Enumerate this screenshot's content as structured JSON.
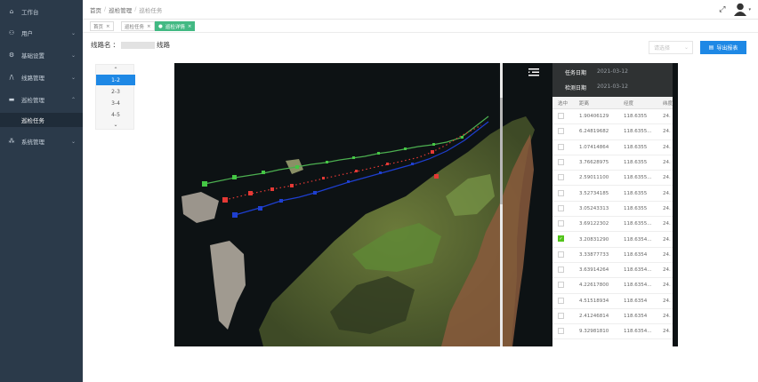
{
  "sidebar": {
    "items": [
      {
        "label": "工作台",
        "icon": "home-icon"
      },
      {
        "label": "用户",
        "icon": "user-icon"
      },
      {
        "label": "基础设置",
        "icon": "settings-icon"
      },
      {
        "label": "线路管理",
        "icon": "route-icon"
      },
      {
        "label": "巡检管理",
        "icon": "folder-icon"
      },
      {
        "label": "巡检任务",
        "icon": ""
      },
      {
        "label": "系统管理",
        "icon": "sitemap-icon"
      }
    ]
  },
  "topbar": {
    "breadcrumb": [
      "首页",
      "巡检管理",
      "巡检任务"
    ]
  },
  "tabs": [
    {
      "label": "首页"
    },
    {
      "label": "巡检任务"
    },
    {
      "label": "巡检详情"
    }
  ],
  "page": {
    "title_prefix": "线路名",
    "title_suffix": "线路"
  },
  "toolbar": {
    "select_placeholder": "请选择",
    "export_label": "导出报表"
  },
  "segments": {
    "up": "⌃",
    "items": [
      "1-2",
      "2-3",
      "3-4",
      "4-5"
    ],
    "down": "⌄",
    "active_index": 0
  },
  "panel": {
    "task_date_label": "任务日期",
    "task_date_value": "2021-03-12",
    "check_date_label": "检测日期",
    "check_date_value": "2021-03-12",
    "columns": [
      "选中",
      "距离",
      "经度",
      "纬度"
    ],
    "rows": [
      {
        "checked": false,
        "distance": "1.90406129",
        "lon": "118.6355",
        "lat": "24."
      },
      {
        "checked": false,
        "distance": "6.24819682",
        "lon": "118.6355...",
        "lat": "24."
      },
      {
        "checked": false,
        "distance": "1.07414864",
        "lon": "118.6355",
        "lat": "24."
      },
      {
        "checked": false,
        "distance": "3.76628975",
        "lon": "118.6355",
        "lat": "24."
      },
      {
        "checked": false,
        "distance": "2.59011100",
        "lon": "118.6355...",
        "lat": "24."
      },
      {
        "checked": false,
        "distance": "3.52734185",
        "lon": "118.6355",
        "lat": "24."
      },
      {
        "checked": false,
        "distance": "3.05243313",
        "lon": "118.6355",
        "lat": "24."
      },
      {
        "checked": false,
        "distance": "3.69122302",
        "lon": "118.6355...",
        "lat": "24."
      },
      {
        "checked": true,
        "distance": "3.20831290",
        "lon": "118.6354...",
        "lat": "24."
      },
      {
        "checked": false,
        "distance": "3.33877733",
        "lon": "118.6354",
        "lat": "24."
      },
      {
        "checked": false,
        "distance": "3.63914264",
        "lon": "118.6354...",
        "lat": "24."
      },
      {
        "checked": false,
        "distance": "4.22617800",
        "lon": "118.6354...",
        "lat": "24."
      },
      {
        "checked": false,
        "distance": "4.51518934",
        "lon": "118.6354",
        "lat": "24."
      },
      {
        "checked": false,
        "distance": "2.41246814",
        "lon": "118.6354",
        "lat": "24."
      },
      {
        "checked": false,
        "distance": "9.32981810",
        "lon": "118.6354...",
        "lat": "24."
      }
    ]
  },
  "colors": {
    "sidebar_bg": "#2b3a4a",
    "primary": "#1e88e5",
    "tab_active": "#42b983",
    "wire_green": "#4caf50",
    "wire_red": "#e53935",
    "wire_blue": "#1e3fd0"
  }
}
